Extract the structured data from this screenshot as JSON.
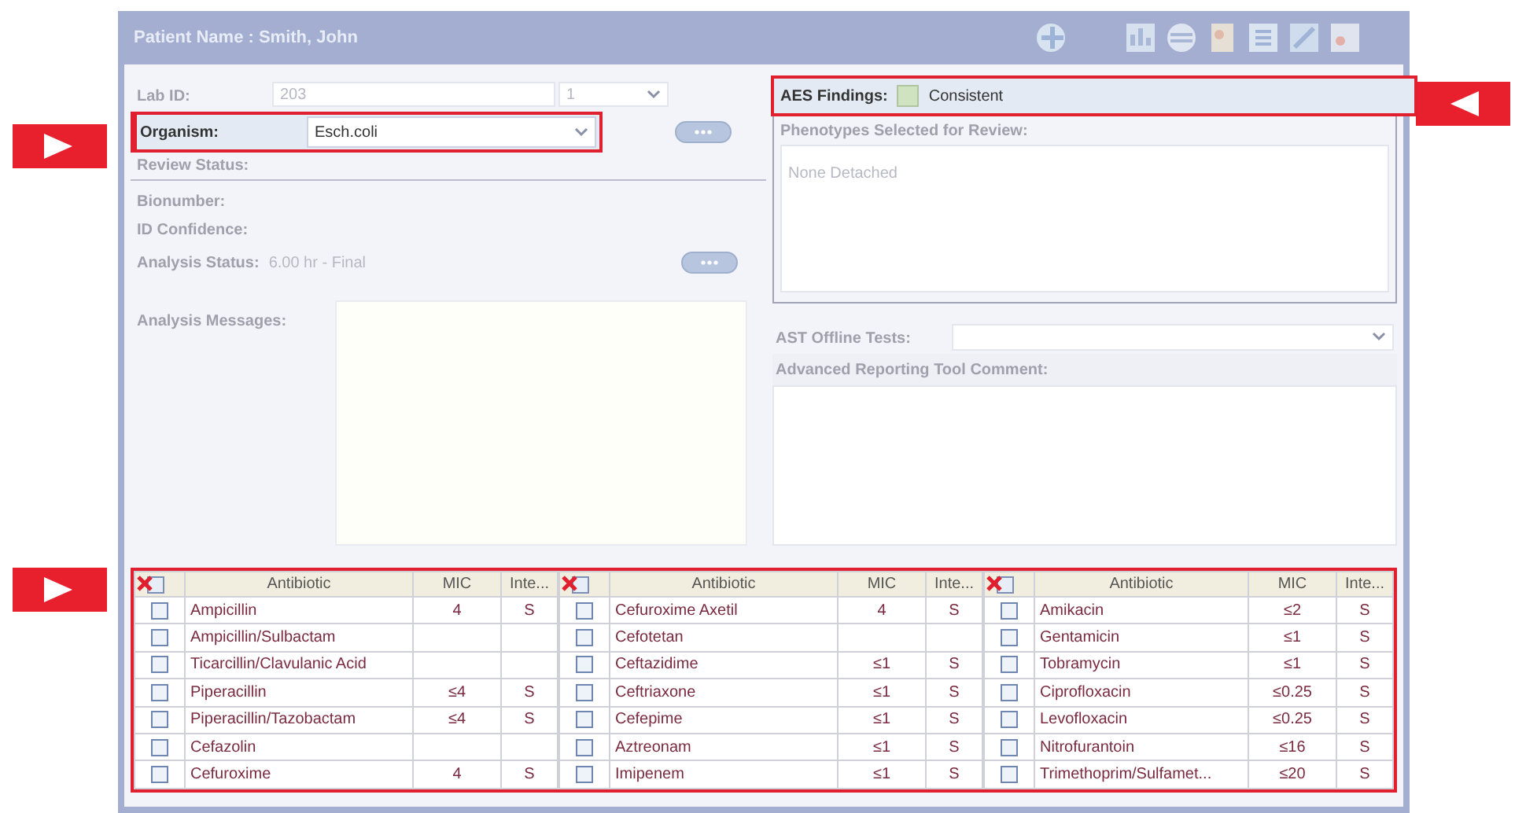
{
  "window": {
    "title": "Patient Name : Smith, John"
  },
  "left": {
    "lab_id": {
      "label": "Lab ID:",
      "value": "203",
      "suffix": "1",
      "disabled": true
    },
    "organism": {
      "label": "Organism:",
      "value": "Esch.coli"
    },
    "review_status": {
      "label": "Review Status:"
    },
    "bionumber": {
      "label": "Bionumber:"
    },
    "id_confidence": {
      "label": "ID Confidence:"
    },
    "analysis_status": {
      "label": "Analysis Status:",
      "value": "6.00 hr - Final"
    },
    "analysis_messages": {
      "label": "Analysis Messages:"
    }
  },
  "right": {
    "aes_findings": {
      "label": "AES Findings:",
      "value": "Consistent",
      "color": "#cfe3c0"
    },
    "phenotypes": {
      "label": "Phenotypes Selected for Review:",
      "value": "None Detached"
    },
    "ast_offline": {
      "label": "AST Offline Tests:"
    },
    "art_comment": {
      "label": "Advanced Reporting Tool Comment:"
    }
  },
  "table": {
    "groups": [
      {
        "columns": [
          "Antibiotic",
          "MIC",
          "Inte..."
        ],
        "rows": [
          {
            "antibiotic": "Ampicillin",
            "mic": "4",
            "interp": "S",
            "checked": false
          },
          {
            "antibiotic": "Ampicillin/Sulbactam",
            "mic": "",
            "interp": "",
            "checked": false
          },
          {
            "antibiotic": "Ticarcillin/Clavulanic Acid",
            "mic": "",
            "interp": "",
            "checked": false
          },
          {
            "antibiotic": "Piperacillin",
            "mic": "≤4",
            "interp": "S",
            "checked": false
          },
          {
            "antibiotic": "Piperacillin/Tazobactam",
            "mic": "≤4",
            "interp": "S",
            "checked": false
          },
          {
            "antibiotic": "Cefazolin",
            "mic": "",
            "interp": "",
            "checked": false
          },
          {
            "antibiotic": "Cefuroxime",
            "mic": "4",
            "interp": "S",
            "checked": false
          }
        ]
      },
      {
        "columns": [
          "Antibiotic",
          "MIC",
          "Inte..."
        ],
        "rows": [
          {
            "antibiotic": "Cefuroxime Axetil",
            "mic": "4",
            "interp": "S",
            "checked": false
          },
          {
            "antibiotic": "Cefotetan",
            "mic": "",
            "interp": "",
            "checked": false
          },
          {
            "antibiotic": "Ceftazidime",
            "mic": "≤1",
            "interp": "S",
            "checked": false
          },
          {
            "antibiotic": "Ceftriaxone",
            "mic": "≤1",
            "interp": "S",
            "checked": false
          },
          {
            "antibiotic": "Cefepime",
            "mic": "≤1",
            "interp": "S",
            "checked": false
          },
          {
            "antibiotic": "Aztreonam",
            "mic": "≤1",
            "interp": "S",
            "checked": false
          },
          {
            "antibiotic": "Imipenem",
            "mic": "≤1",
            "interp": "S",
            "checked": false
          }
        ]
      },
      {
        "columns": [
          "Antibiotic",
          "MIC",
          "Inte..."
        ],
        "rows": [
          {
            "antibiotic": "Amikacin",
            "mic": "≤2",
            "interp": "S",
            "checked": false
          },
          {
            "antibiotic": "Gentamicin",
            "mic": "≤1",
            "interp": "S",
            "checked": false
          },
          {
            "antibiotic": "Tobramycin",
            "mic": "≤1",
            "interp": "S",
            "checked": false
          },
          {
            "antibiotic": "Ciprofloxacin",
            "mic": "≤0.25",
            "interp": "S",
            "checked": false
          },
          {
            "antibiotic": "Levofloxacin",
            "mic": "≤0.25",
            "interp": "S",
            "checked": false
          },
          {
            "antibiotic": "Nitrofurantoin",
            "mic": "≤16",
            "interp": "S",
            "checked": false
          },
          {
            "antibiotic": "Trimethoprim/Sulfamet...",
            "mic": "≤20",
            "interp": "S",
            "checked": false
          }
        ]
      }
    ]
  }
}
